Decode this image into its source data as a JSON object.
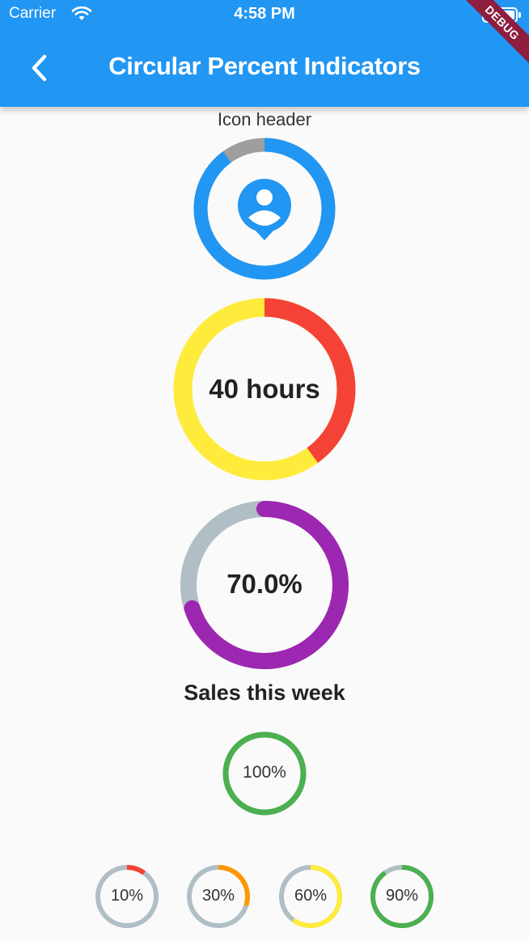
{
  "status_bar": {
    "carrier": "Carrier",
    "time": "4:58 PM"
  },
  "app_bar": {
    "title": "Circular Percent Indicators",
    "back_icon": "chevron-left-icon"
  },
  "debug_banner": "DEBUG",
  "indicators": {
    "icon_ring": {
      "header": "Icon header",
      "percent": 0.9,
      "progress_color": "#2196f3",
      "background_color": "#9e9e9e",
      "icon": "person-pin-icon"
    },
    "hours_ring": {
      "center_text": "40 hours",
      "percent": 0.4,
      "progress_color": "#f44336",
      "background_color": "#ffeb3b"
    },
    "sales_ring": {
      "center_text": "70.0%",
      "percent": 0.7,
      "footer": "Sales this week",
      "progress_color": "#9c27b0",
      "background_color": "#b0bec5"
    },
    "full_ring": {
      "center_text": "100%",
      "percent": 1.0,
      "progress_color": "#4caf50",
      "background_color": "#b0bec5"
    },
    "small_rings": [
      {
        "label": "10%",
        "percent": 0.1,
        "progress_color": "#f44336",
        "background_color": "#b0bec5"
      },
      {
        "label": "30%",
        "percent": 0.3,
        "progress_color": "#ff9800",
        "background_color": "#b0bec5"
      },
      {
        "label": "60%",
        "percent": 0.6,
        "progress_color": "#ffeb3b",
        "background_color": "#b0bec5"
      },
      {
        "label": "90%",
        "percent": 0.9,
        "progress_color": "#4caf50",
        "background_color": "#b0bec5"
      }
    ]
  }
}
